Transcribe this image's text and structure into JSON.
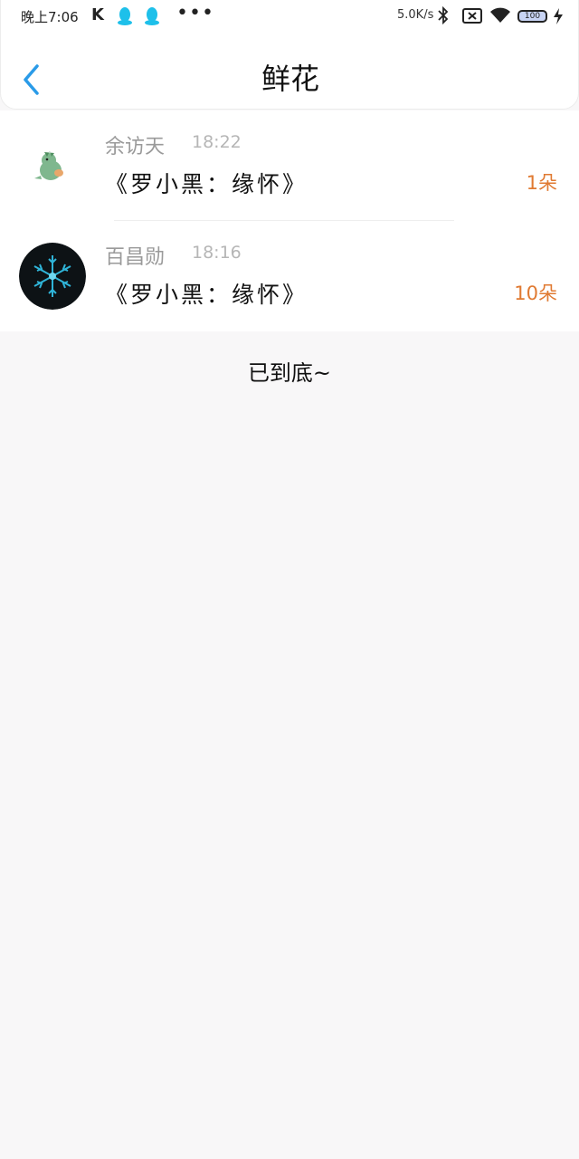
{
  "status_bar": {
    "time": "晚上7:06",
    "k_label": "K",
    "more": "•••",
    "net_speed": "5.0K/s",
    "battery": "100"
  },
  "header": {
    "back_icon": "chevron-left-icon",
    "title": "鲜花"
  },
  "items": [
    {
      "name": "余访天",
      "time": "18:22",
      "book": "《罗小黑：缘怀》",
      "amount": "1朵",
      "avatar": "dinosaur-sticker"
    },
    {
      "name": "百昌勋",
      "time": "18:16",
      "book": "《罗小黑：缘怀》",
      "amount": "10朵",
      "avatar": "snowflake-image"
    }
  ],
  "footer": {
    "end_text": "已到底~"
  },
  "colors": {
    "accent": "#2a9be8",
    "amount": "#e07a32",
    "qq": "#1ec0ea"
  }
}
